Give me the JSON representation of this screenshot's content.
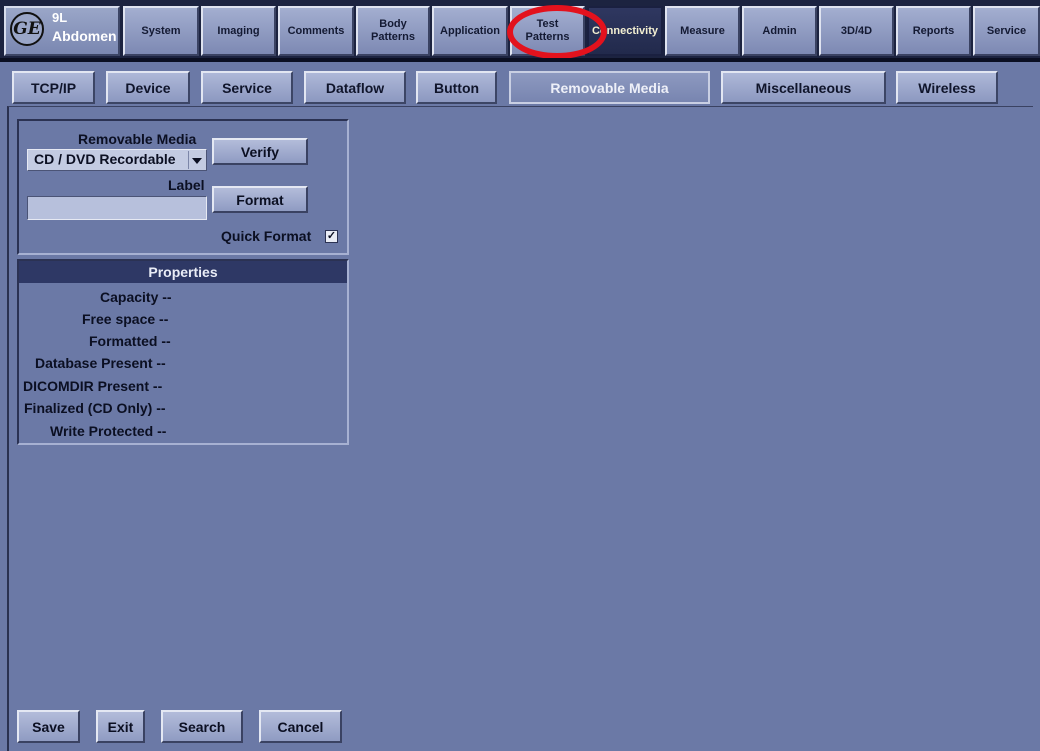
{
  "header": {
    "probe": "9L",
    "preset": "Abdomen",
    "menu": [
      {
        "label": "System",
        "active": false
      },
      {
        "label": "Imaging",
        "active": false
      },
      {
        "label": "Comments",
        "active": false
      },
      {
        "label": "Body\nPatterns",
        "active": false
      },
      {
        "label": "Application",
        "active": false
      },
      {
        "label": "Test\nPatterns",
        "active": false
      },
      {
        "label": "Connectivity",
        "active": true
      },
      {
        "label": "Measure",
        "active": false
      },
      {
        "label": "Admin",
        "active": false
      },
      {
        "label": "3D/4D",
        "active": false
      },
      {
        "label": "Reports",
        "active": false
      },
      {
        "label": "Service",
        "active": false
      }
    ],
    "annotation_color": "#e3121d"
  },
  "tabs": [
    {
      "label": "TCP/IP",
      "active": false
    },
    {
      "label": "Device",
      "active": false
    },
    {
      "label": "Service",
      "active": false
    },
    {
      "label": "Dataflow",
      "active": false
    },
    {
      "label": "Button",
      "active": false
    },
    {
      "label": "Removable Media",
      "active": true
    },
    {
      "label": "Miscellaneous",
      "active": false
    },
    {
      "label": "Wireless",
      "active": false
    }
  ],
  "media": {
    "section_label": "Removable Media",
    "selected_media": "CD / DVD Recordable",
    "label_caption": "Label",
    "label_value": "",
    "verify_label": "Verify",
    "format_label": "Format",
    "quick_format_label": "Quick Format",
    "quick_format_checked": true
  },
  "properties": {
    "title": "Properties",
    "rows": [
      "Capacity --",
      "Free space --",
      "Formatted --",
      "Database Present --",
      "DICOMDIR Present --",
      "Finalized (CD Only) --",
      "Write Protected --"
    ]
  },
  "footer": {
    "save_label": "Save",
    "exit_label": "Exit",
    "search_label": "Search",
    "cancel_label": "Cancel"
  },
  "colors": {
    "background": "#6b79a6",
    "menu_bar": "#1c2340",
    "active_tab_text": "#f3efd2",
    "properties_header": "#2e3865"
  }
}
